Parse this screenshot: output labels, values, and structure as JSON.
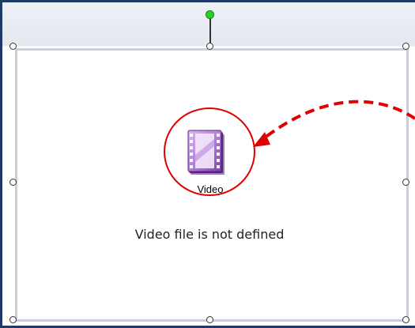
{
  "placeholder": {
    "icon_label": "Video",
    "status_text": "Video file is not defined"
  },
  "icons": {
    "video": "video-film-icon",
    "handle": "resize-handle",
    "rotate": "rotate-handle"
  },
  "colors": {
    "frame_border": "#1f3a68",
    "placeholder_border": "#c9cfd8",
    "rotate_handle": "#2bd12b",
    "annotation": "#e00000",
    "icon_purple": "#9b59c8"
  }
}
